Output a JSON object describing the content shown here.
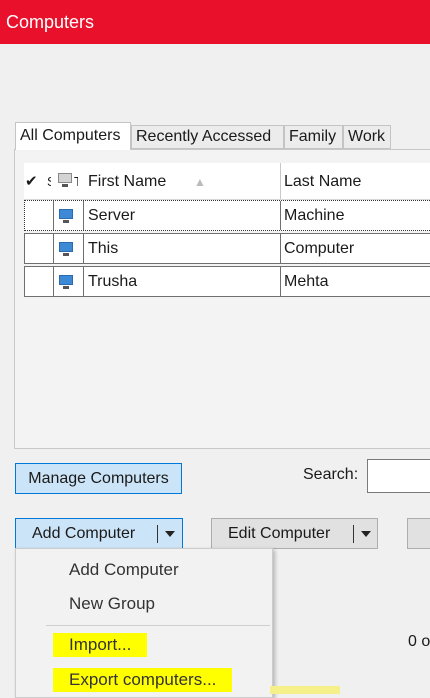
{
  "window": {
    "title": "Computers"
  },
  "tabs": [
    {
      "label": "All Computers",
      "active": true
    },
    {
      "label": "Recently Accessed",
      "active": false
    },
    {
      "label": "Family",
      "active": false
    },
    {
      "label": "Work",
      "active": false
    }
  ],
  "grid": {
    "columns": [
      "✔",
      "S",
      "T",
      "First Name",
      "Last Name"
    ],
    "sort_indicator": "▲",
    "rows": [
      {
        "first_name": "Server",
        "last_name": "Machine",
        "selected": true
      },
      {
        "first_name": "This",
        "last_name": "Computer",
        "selected": false
      },
      {
        "first_name": "Trusha",
        "last_name": "Mehta",
        "selected": false
      }
    ]
  },
  "buttons": {
    "manage": "Manage Computers",
    "add": "Add Computer",
    "edit": "Edit Computer"
  },
  "search": {
    "label": "Search:",
    "value": ""
  },
  "status": {
    "count_text": "0 o"
  },
  "menu": {
    "items": [
      {
        "label": "Add Computer",
        "highlighted": false
      },
      {
        "label": "New Group",
        "highlighted": false
      },
      {
        "label": "Import...",
        "highlighted": true
      },
      {
        "label": "Export computers...",
        "highlighted": true
      }
    ]
  },
  "colors": {
    "titlebar": "#e8102a",
    "accent_blue": "#0078d7",
    "highlight": "#ffff00"
  }
}
